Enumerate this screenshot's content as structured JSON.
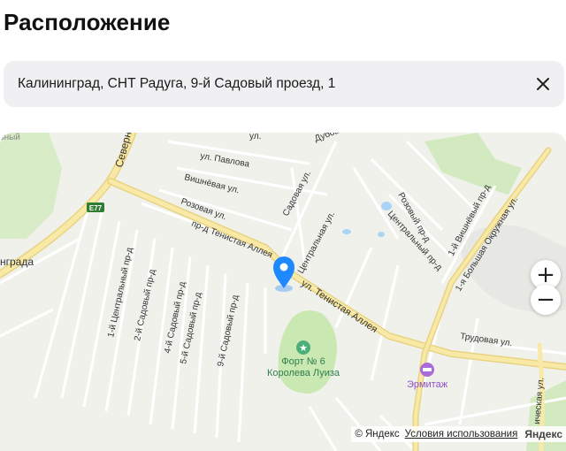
{
  "page": {
    "title": "Расположение"
  },
  "address": {
    "value": "Калининград, СНТ Радуга, 9-й Садовый проезд, 1"
  },
  "map": {
    "labels": {
      "road_severnaya": "Северн",
      "kaliningrad": "нграда",
      "e77": "E77",
      "pavlova": "ул. Павлова",
      "vishnevaya": "Вишнёвая ул.",
      "rozovaya": "Розовая ул.",
      "dubovaya": "Дубовая",
      "sadovaya": "Садовая ул.",
      "tsentralnaya": "Центральная ул.",
      "tenistaya_pr": "пр-д Тенистая Аллея",
      "tenistaya_ul": "ул. Тенистая Аллея",
      "rozovy_pr": "Розовый пр-д",
      "tsentralny_pr": "Центральный пр-д",
      "vishnevy_pr": "1-й Вишнёвый пр-д",
      "bolshaya_okr": "1-я Большая Окружная ул.",
      "trudovaya": "Трудовая ул.",
      "c1": "1-й Центральный пр-д",
      "s2": "2-й Садовый пр-д",
      "s4": "4-й Садовый пр-д",
      "s5": "5-й Садовый пр-д",
      "s9": "9-й Садовый пр-д",
      "fort": "Форт № 6",
      "luiza": "Королева Луиза",
      "ermitazh": "Эрмитаж",
      "pavlova_top": "ул.",
      "khimicheskaya": "ическая ул.",
      "zny": "зный"
    },
    "zoom_in": "+",
    "zoom_out": "−",
    "attribution": "© Яндекс",
    "terms": "Условия использования",
    "logo": "Яндекс"
  },
  "colors": {
    "accent": "#1e88ff",
    "park": "#c9e8b2",
    "road_major": "#f4e29a"
  }
}
